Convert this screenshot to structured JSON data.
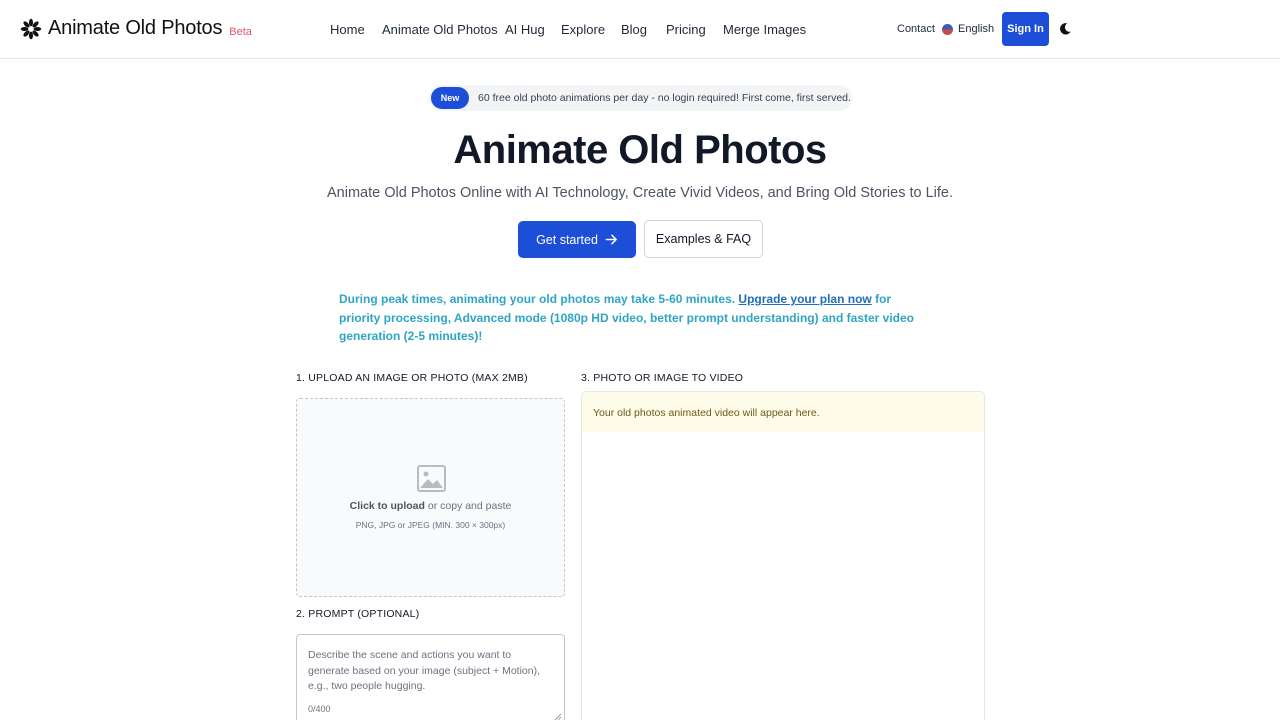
{
  "header": {
    "logo_text": "Animate Old Photos",
    "beta": "Beta",
    "nav": [
      "Home",
      "Animate Old Photos",
      "AI Hug",
      "Explore",
      "Blog",
      "Pricing",
      "Merge Images"
    ],
    "contact": "Contact",
    "language": "English",
    "sign_in": "Sign In",
    "theme_icon": "moon-icon"
  },
  "announcement": {
    "badge": "New",
    "text": "60 free old photo animations per day - no login required! First come, first served."
  },
  "hero": {
    "title": "Animate Old Photos",
    "subtitle": "Animate Old Photos Online with AI Technology, Create Vivid Videos, and Bring Old Stories to Life.",
    "primary_button": "Get started",
    "secondary_button": "Examples & FAQ"
  },
  "notice": {
    "before": "During peak times, animating your old photos may take 5-60 minutes. ",
    "link": "Upgrade your plan now",
    "after": " for priority processing, Advanced mode (1080p HD video, better prompt understanding) and faster video generation (2-5 minutes)!"
  },
  "upload": {
    "label": "1. UPLOAD AN IMAGE OR PHOTO (MAX 2MB)",
    "click": "Click to upload",
    "or_paste": " or copy and paste",
    "hint": "PNG, JPG or JPEG (MIN. 300 × 300px)"
  },
  "prompt": {
    "label": "2. PROMPT (OPTIONAL)",
    "placeholder": "Describe the scene and actions you want to generate based on your image (subject + Motion), e.g., two people hugging.",
    "counter": "0/400"
  },
  "video": {
    "label": "3. PHOTO OR IMAGE TO VIDEO",
    "message": "Your old photos animated video will appear here."
  },
  "colors": {
    "accent": "#1d4ed8",
    "notice": "#2ea5c5",
    "beta": "#e0556b"
  }
}
